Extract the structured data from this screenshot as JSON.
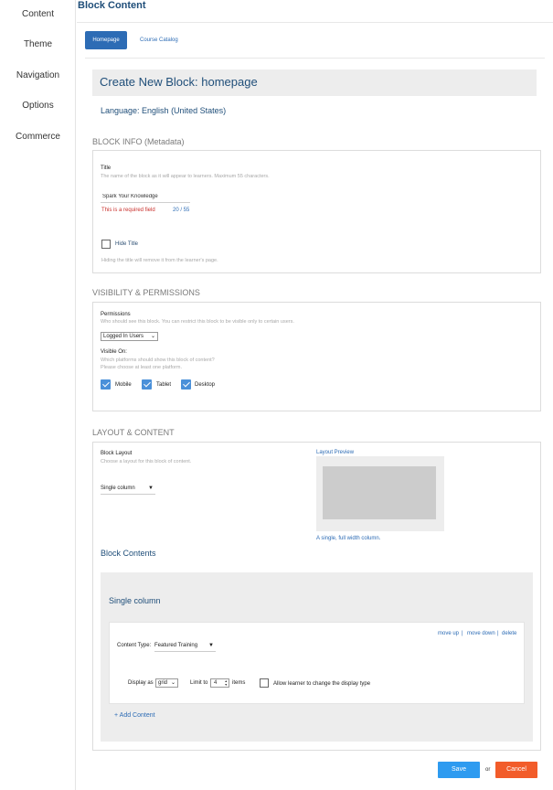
{
  "sidebar": {
    "items": [
      {
        "label": "Content"
      },
      {
        "label": "Theme"
      },
      {
        "label": "Navigation"
      },
      {
        "label": "Options"
      },
      {
        "label": "Commerce"
      }
    ]
  },
  "header": {
    "title": "Block Content"
  },
  "tabs": [
    {
      "label": "Homepage",
      "active": true
    },
    {
      "label": "Course Catalog",
      "active": false
    }
  ],
  "create": {
    "title": "Create New Block: homepage",
    "language": "Language: English (United States)"
  },
  "block_info": {
    "section_title": "BLOCK INFO (Metadata)",
    "title_label": "Title",
    "title_hint": "The name of the block as it will appear to learners. Maximum 55 characters.",
    "title_value": "Spark Your Knowledge",
    "required_error": "This is a required field",
    "char_count": "20 / 55",
    "hide_title_label": "Hide Title",
    "hide_title_checked": false,
    "hide_title_hint": "Hiding the title will remove it from the learner's page."
  },
  "visibility": {
    "section_title": "VISIBILITY & PERMISSIONS",
    "permissions_label": "Permissions",
    "permissions_hint": "Who should see this block. You can restrict this block to be visible only to certain users.",
    "permissions_value": "Logged In Users",
    "visible_on_label": "Visible On:",
    "visible_on_hint_1": "Which platforms should show this block of content?",
    "visible_on_hint_2": "Please choose at least one platform.",
    "platforms": [
      {
        "label": "Mobile",
        "checked": true
      },
      {
        "label": "Tablet",
        "checked": true
      },
      {
        "label": "Desktop",
        "checked": true
      }
    ]
  },
  "layout": {
    "section_title": "LAYOUT & CONTENT",
    "block_layout_label": "Block Layout",
    "block_layout_hint": "Choose a layout for this block of content.",
    "block_layout_value": "Single column",
    "preview_label": "Layout Preview",
    "preview_caption": "A single, full width column.",
    "block_contents_title": "Block Contents",
    "column_title": "Single column",
    "move_up": "move up",
    "move_down": "move down",
    "delete": "delete",
    "content_type_label": "Content Type:",
    "content_type_value": "Featured Training",
    "display_as_label": "Display as",
    "display_as_value": "grid",
    "limit_to_label": "Limit to",
    "limit_value": "4",
    "items_label": "items",
    "allow_change_label": "Allow learner to change the display type",
    "allow_change_checked": false,
    "add_content": "+ Add Content"
  },
  "actions": {
    "save": "Save",
    "or": "or",
    "cancel": "Cancel"
  },
  "colors": {
    "brand_blue": "#2d6cb5",
    "title_navy": "#1f4e79",
    "save_blue": "#2e9bf0",
    "cancel_orange": "#f25c2a",
    "error_red": "#c9302c",
    "checkbox_blue": "#4a90d9"
  }
}
